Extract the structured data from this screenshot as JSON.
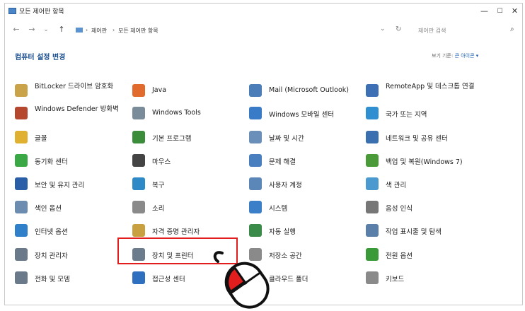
{
  "window": {
    "title": "모든 제어판 항목",
    "controls": [
      "—",
      "☐",
      "✕"
    ]
  },
  "nav": {
    "back": "←",
    "forward": "→",
    "recent": "⌄",
    "up": "↑",
    "breadcrumb": [
      "제어판",
      "모든 제어판 항목"
    ],
    "refresh": "↻",
    "dropdown": "⌄",
    "search_placeholder": "제어판 검색",
    "search_icon": "⌕"
  },
  "header": {
    "title": "컴퓨터 설정 변경",
    "view_by_label": "보기 기준:",
    "view_by_value": "큰 아이콘 ▾"
  },
  "items": [
    {
      "label": "BitLocker 드라이브 암호화",
      "icon": "bitlocker-icon",
      "color": "#c9a24a"
    },
    {
      "label": "Java",
      "icon": "java-icon",
      "color": "#e06b2c"
    },
    {
      "label": "Mail (Microsoft Outlook)",
      "icon": "mail-icon",
      "color": "#4b7db8"
    },
    {
      "label": "RemoteApp 및 데스크톱 연결",
      "icon": "remoteapp-icon",
      "color": "#3d6fb5"
    },
    {
      "label": "Windows Defender 방화벽",
      "icon": "firewall-icon",
      "color": "#b5472f"
    },
    {
      "label": "Windows Tools",
      "icon": "tools-icon",
      "color": "#7a8b99"
    },
    {
      "label": "Windows 모바일 센터",
      "icon": "mobility-icon",
      "color": "#3a7bc8"
    },
    {
      "label": "국가 또는 지역",
      "icon": "region-icon",
      "color": "#2f8fd0"
    },
    {
      "label": "글꼴",
      "icon": "fonts-icon",
      "color": "#e0b030"
    },
    {
      "label": "기본 프로그램",
      "icon": "default-programs-icon",
      "color": "#3b8c3b"
    },
    {
      "label": "날짜 및 시간",
      "icon": "datetime-icon",
      "color": "#6a8fb8"
    },
    {
      "label": "네트워크 및 공유 센터",
      "icon": "network-icon",
      "color": "#3a6fb0"
    },
    {
      "label": "동기화 센터",
      "icon": "sync-icon",
      "color": "#3aa844"
    },
    {
      "label": "마우스",
      "icon": "mouse-icon",
      "color": "#444444"
    },
    {
      "label": "문제 해결",
      "icon": "troubleshoot-icon",
      "color": "#4a7fbf"
    },
    {
      "label": "백업 및 복원(Windows 7)",
      "icon": "backup-icon",
      "color": "#4a9a3a"
    },
    {
      "label": "보안 및 유지 관리",
      "icon": "security-icon",
      "color": "#2a5fa8"
    },
    {
      "label": "복구",
      "icon": "recovery-icon",
      "color": "#2d8ac7"
    },
    {
      "label": "사용자 계정",
      "icon": "user-accounts-icon",
      "color": "#5a86b8"
    },
    {
      "label": "색 관리",
      "icon": "color-management-icon",
      "color": "#4a9ad0"
    },
    {
      "label": "색인 옵션",
      "icon": "indexing-icon",
      "color": "#6c8db0"
    },
    {
      "label": "소리",
      "icon": "sound-icon",
      "color": "#8a8a8a"
    },
    {
      "label": "시스템",
      "icon": "system-icon",
      "color": "#3a7fc8"
    },
    {
      "label": "음성 인식",
      "icon": "speech-icon",
      "color": "#777777"
    },
    {
      "label": "인터넷 옵션",
      "icon": "internet-options-icon",
      "color": "#2f7fc9"
    },
    {
      "label": "자격 증명 관리자",
      "icon": "credential-icon",
      "color": "#c9a040"
    },
    {
      "label": "자동 실행",
      "icon": "autoplay-icon",
      "color": "#3a8a4a"
    },
    {
      "label": "작업 표시줄 및 탐색",
      "icon": "taskbar-icon",
      "color": "#5a7fa8"
    },
    {
      "label": "장치 관리자",
      "icon": "device-manager-icon",
      "color": "#6a7a8a"
    },
    {
      "label": "장치 및 프린터",
      "icon": "devices-printers-icon",
      "color": "#6c7c8c"
    },
    {
      "label": "저장소 공간",
      "icon": "storage-spaces-icon",
      "color": "#8a8a8a"
    },
    {
      "label": "전원 옵션",
      "icon": "power-icon",
      "color": "#3a9a3a"
    },
    {
      "label": "전화 및 모뎀",
      "icon": "phone-modem-icon",
      "color": "#6a7a8a"
    },
    {
      "label": "접근성 센터",
      "icon": "ease-of-access-icon",
      "color": "#2f6fc0"
    },
    {
      "label": "클라우드 폴더",
      "icon": "work-folders-icon",
      "color": "#3a7fc8"
    },
    {
      "label": "키보드",
      "icon": "keyboard-icon",
      "color": "#8a8a8a"
    }
  ]
}
